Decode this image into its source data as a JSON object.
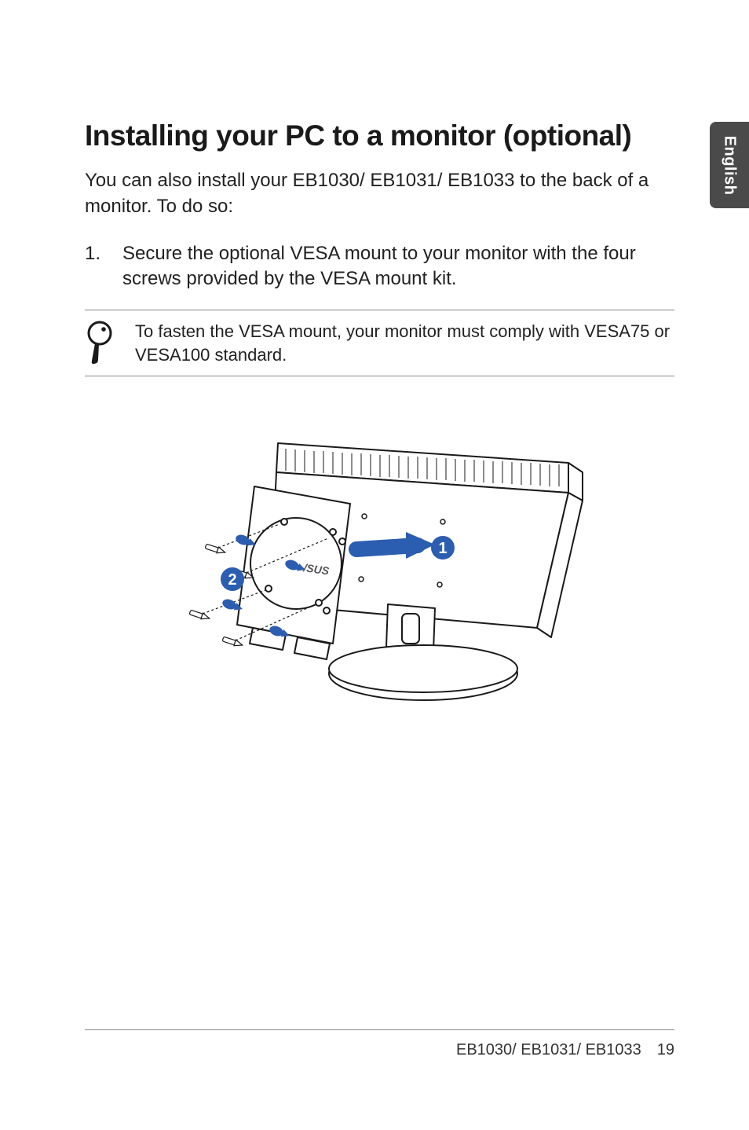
{
  "side_tab": {
    "label": "English"
  },
  "heading": "Installing your PC to a monitor (optional)",
  "intro": "You can also install your EB1030/ EB1031/ EB1033 to the back of a monitor. To do so:",
  "steps": [
    {
      "num": "1.",
      "text": "Secure the optional VESA mount to your monitor with the four screws provided by the VESA mount kit."
    }
  ],
  "note": {
    "icon_name": "magnifier-icon",
    "text": "To fasten the VESA mount, your monitor must comply with VESA75 or VESA100 standard."
  },
  "illustration": {
    "callouts": {
      "one": "1",
      "two": "2"
    },
    "description": "Monitor rear with VESA mounting plate and four screws"
  },
  "footer": {
    "model": "EB1030/ EB1031/ EB1033",
    "page": "19"
  }
}
